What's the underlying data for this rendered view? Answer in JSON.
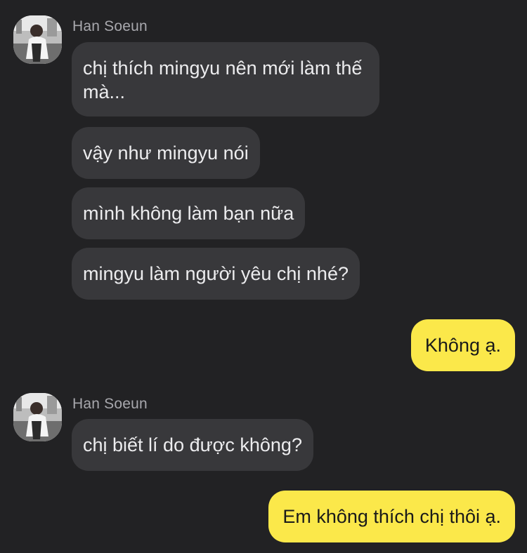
{
  "conversation": {
    "groups": [
      {
        "sender": "Han Soeun",
        "messages": [
          "chị thích mingyu nên mới làm thế mà...",
          "vậy như mingyu nói",
          "mình không làm bạn nữa",
          "mingyu làm người yêu chị nhé?"
        ]
      },
      {
        "outgoing": [
          "Không ạ."
        ]
      },
      {
        "sender": "Han Soeun",
        "messages": [
          "chị biết lí do được không?"
        ]
      },
      {
        "outgoing": [
          "Em không thích chị thôi ạ."
        ]
      }
    ]
  },
  "colors": {
    "background": "#222224",
    "incoming_bubble": "#38383b",
    "outgoing_bubble": "#fbe84a",
    "sender_name": "#a8a8ad"
  }
}
